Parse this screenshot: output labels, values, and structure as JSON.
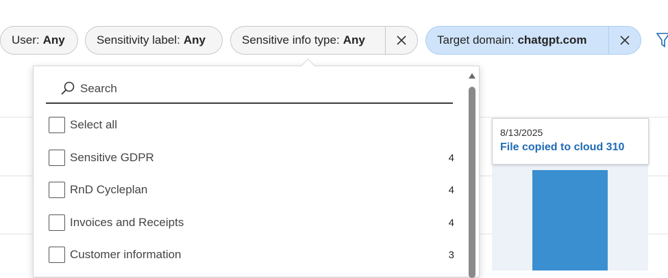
{
  "filters": [
    {
      "label": "User:",
      "value": "Any"
    },
    {
      "label": "Sensitivity label:",
      "value": "Any"
    },
    {
      "label": "Sensitive info type:",
      "value": "Any"
    },
    {
      "label": "Target domain:",
      "value": "chatgpt.com"
    }
  ],
  "dropdown": {
    "search_placeholder": "Search",
    "options": [
      {
        "label": "Select all",
        "count": ""
      },
      {
        "label": "Sensitive GDPR",
        "count": "4"
      },
      {
        "label": "RnD Cycleplan",
        "count": "4"
      },
      {
        "label": "Invoices and Receipts",
        "count": "4"
      },
      {
        "label": "Customer information",
        "count": "3"
      }
    ]
  },
  "tooltip": {
    "date": "8/13/2025",
    "series_value": "File copied to cloud 310"
  },
  "colors": {
    "accent": "#3a8fd0",
    "active_pill": "#cfe4fa",
    "tooltip_value": "#1f6bb5"
  }
}
